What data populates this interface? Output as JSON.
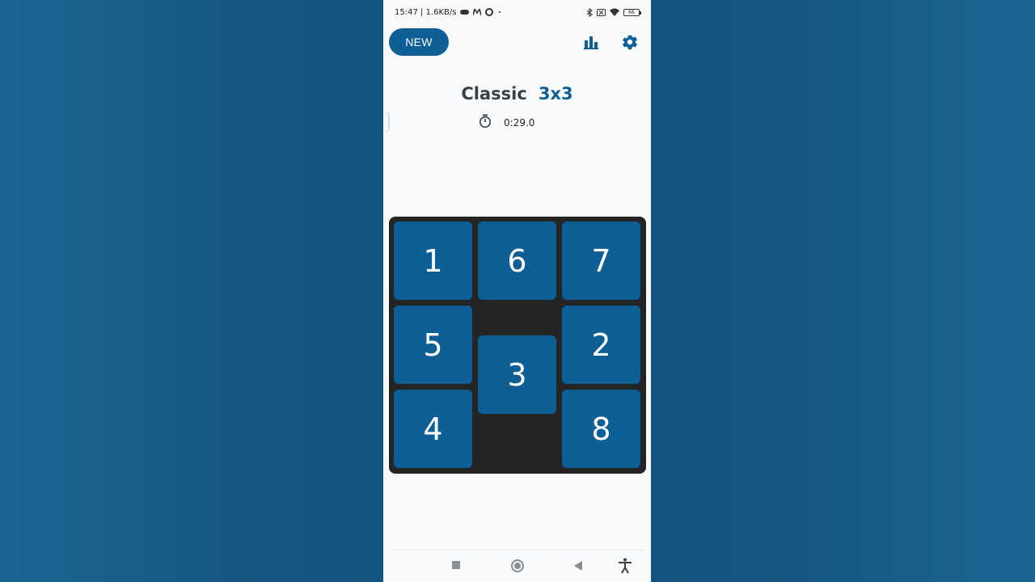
{
  "status_bar": {
    "time_speed": "15:47 | 1.6KB/s",
    "battery": "66"
  },
  "toolbar": {
    "new_label": "NEW",
    "stats_icon": "bar-chart-icon",
    "settings_icon": "gear-icon"
  },
  "game": {
    "mode": "Classic",
    "size": "3x3",
    "timer": "0:29.0"
  },
  "board": {
    "tiles": [
      "1",
      "6",
      "7",
      "5",
      "3",
      "2",
      "4",
      "8"
    ]
  },
  "colors": {
    "accent": "#0e5f95",
    "board": "#242424",
    "background": "#1a5f8f"
  }
}
